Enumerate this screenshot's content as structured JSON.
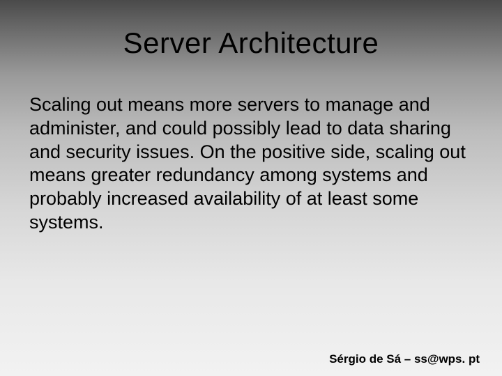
{
  "title": "Server Architecture",
  "body": "Scaling out means more servers to manage and administer, and could possibly lead to data sharing and security issues. On the positive side, scaling out means greater redundancy among systems and probably increased availability of at least some systems.",
  "footer": "Sérgio de Sá – ss@wps. pt"
}
